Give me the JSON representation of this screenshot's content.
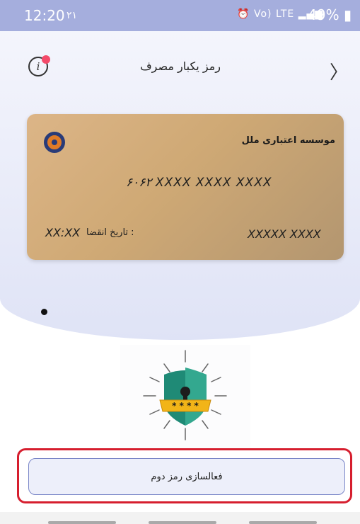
{
  "status_bar": {
    "time": "12:20",
    "date": "۲۱",
    "network": "Vo) LTE",
    "battery": "49%"
  },
  "header": {
    "title": "رمز یکبار مصرف",
    "info_icon": "info-icon",
    "back_icon": "chevron-right-icon"
  },
  "card": {
    "bank_name": "موسسه اعتباری ملل",
    "number": "۶۰۶۲  XXXX  XXXX  XXXX",
    "expiry_label": "تاریخ انقضا :",
    "expiry_value": "XX:XX",
    "holder": "XXXXX  XXXX",
    "logo_icon": "bank-logo-icon"
  },
  "illustration": {
    "icon": "shield-lock-icon",
    "stars": "* * * *"
  },
  "action": {
    "label": "فعالسازی رمز دوم"
  },
  "colors": {
    "status_bar": "#a5aedd",
    "card_gold": "#d4ae7e",
    "shield_green": "#1f8a76",
    "shield_band": "#f2b418",
    "highlight": "#d61e2e",
    "button_border": "#7a86c8"
  }
}
